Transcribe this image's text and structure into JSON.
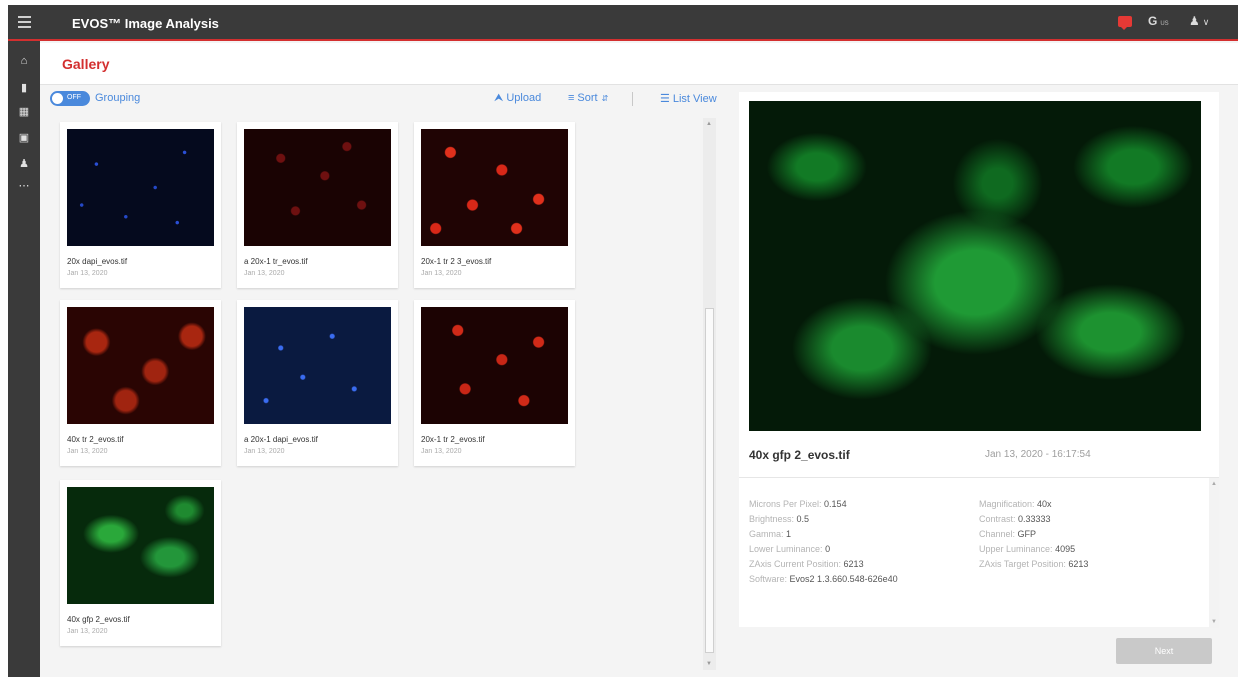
{
  "app": {
    "title": "EVOS™ Image Analysis",
    "lang": "G",
    "lang_sub": "US"
  },
  "page": {
    "title": "Gallery"
  },
  "toolbar": {
    "grouping_toggle": "OFF",
    "grouping_label": "Grouping",
    "upload_label": "Upload",
    "sort_label": "Sort",
    "list_view_label": "List View"
  },
  "gallery": {
    "items": [
      {
        "name": "20x dapi_evos.tif",
        "date": "Jan 13, 2020",
        "channel": "blue"
      },
      {
        "name": "a 20x-1 tr_evos.tif",
        "date": "Jan 13, 2020",
        "channel": "dark-red"
      },
      {
        "name": "20x-1 tr 2 3_evos.tif",
        "date": "Jan 13, 2020",
        "channel": "red"
      },
      {
        "name": "40x tr 2_evos.tif",
        "date": "Jan 13, 2020",
        "channel": "red-large"
      },
      {
        "name": "a 20x-1 dapi_evos.tif",
        "date": "Jan 13, 2020",
        "channel": "blue"
      },
      {
        "name": "20x-1 tr 2_evos.tif",
        "date": "Jan 13, 2020",
        "channel": "red"
      },
      {
        "name": "40x gfp 2_evos.tif",
        "date": "Jan 13, 2020",
        "channel": "green"
      }
    ]
  },
  "preview": {
    "name": "40x gfp 2_evos.tif",
    "date": "Jan 13, 2020 - 16:17:54",
    "metadata": {
      "microns_per_pixel": {
        "label": "Microns Per Pixel:",
        "value": "0.154"
      },
      "magnification": {
        "label": "Magnification:",
        "value": "40x"
      },
      "brightness": {
        "label": "Brightness:",
        "value": "0.5"
      },
      "contrast": {
        "label": "Contrast:",
        "value": "0.33333"
      },
      "gamma": {
        "label": "Gamma:",
        "value": "1"
      },
      "channel": {
        "label": "Channel:",
        "value": "GFP"
      },
      "lower_luminance": {
        "label": "Lower Luminance:",
        "value": "0"
      },
      "upper_luminance": {
        "label": "Upper Luminance:",
        "value": "4095"
      },
      "zaxis_current": {
        "label": "ZAxis Current Position:",
        "value": "6213"
      },
      "zaxis_target": {
        "label": "ZAxis Target Position:",
        "value": "6213"
      },
      "software": {
        "label": "Software:",
        "value": "Evos2 1.3.660.548-626e40"
      }
    }
  },
  "actions": {
    "next_label": "Next"
  },
  "colors": {
    "accent_red": "#d32f2f",
    "link_blue": "#4a89dc",
    "topbar": "#3a3a3a"
  },
  "icons": [
    "menu-icon",
    "notification-icon",
    "globe-icon",
    "user-icon",
    "home-icon",
    "folder-icon",
    "grid-icon",
    "save-icon",
    "users-icon",
    "more-icon",
    "upload-icon",
    "sort-icon",
    "list-view-icon"
  ]
}
